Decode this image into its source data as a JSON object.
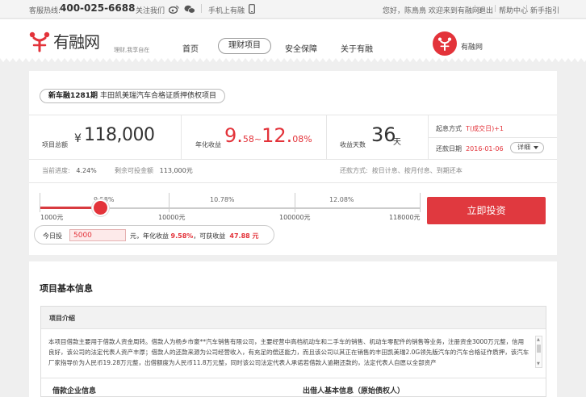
{
  "topbar": {
    "hotline_label": "客服热线:",
    "hotline_number": "400-025-6688",
    "follow_label": "关注我们",
    "mobile_label": "手机上有融",
    "greeting": "您好，陈鳥鳥 欢迎来到有融网!",
    "logout": "退出",
    "help": "帮助中心",
    "guide": "新手指引",
    "separator": "|"
  },
  "header": {
    "logo_text": "有融网",
    "slogan": "理财,我享自在",
    "nav": [
      {
        "label": "首页"
      },
      {
        "label": "理财项目",
        "active": true
      },
      {
        "label": "安全保障"
      },
      {
        "label": "关于有融"
      }
    ],
    "brand_name": "有融网",
    "accent_color": "#e3333a"
  },
  "project": {
    "code": "新车融1281期",
    "name": "丰田凯美瑞汽车合格证质押债权项目",
    "total_label": "项目总额",
    "currency": "¥",
    "total_amount": "118,000",
    "rate_label": "年化收益",
    "rate_min": "9.",
    "rate_min_dec": "58",
    "rate_sep": "~",
    "rate_max": "12.",
    "rate_max_dec": "08",
    "rate_pct": "%",
    "days_label": "收益天数",
    "days": "36",
    "days_unit": "天",
    "start_label": "起息方式",
    "start_value": "T(成交日)+1",
    "end_label": "还款日期",
    "end_value": "2016-01-06",
    "detail_label": "详细",
    "progress_label": "当前进度:",
    "progress_value": "4.24%",
    "remaining_label": "剩余可投金额",
    "remaining_value": "113,000元",
    "repay_label": "还款方式:",
    "repay_value": "按日计息、按月付息、到期还本"
  },
  "slider": {
    "segment_rates": [
      "9.58%",
      "10.78%",
      "12.08%"
    ],
    "axis_labels": [
      "1000元",
      "10000元",
      "100000元",
      "118000元"
    ],
    "current_fraction": 0.16
  },
  "calculator": {
    "label": "今日投",
    "amount": "5000",
    "rate_prefix": "元，年化收益",
    "rate_value": "9.58%",
    "income_prefix": "，可获收益",
    "income_value": "47.88 元"
  },
  "invest_button": "立即投资",
  "info": {
    "title": "项目基本信息",
    "intro_heading": "项目介绍",
    "intro_text": "本项目借款主要用于借款人资金周转。借款人为杨乡市豪**汽车销售有限公司，主要经营中高档机动车和二手车的销售、机动车零配件的销售等业务，注册资金3000万元整，信用良好，该公司的法定代表人资产丰厚；借款人的还款来源为公司经营收入，有充足的偿还能力，而且该公司以其正在销售的丰田凯美瑞2.0G领先版汽车的汽车合格证作质押，该汽车厂家指导价为人民币19.28万元整，出借额度为人民币11.8万元整，同时该公司法定代表人承诺若借款人逾期还款的，法定代表人自愿以全部资产",
    "left_subheading": "借款企业信息",
    "right_subheading": "出借人基本信息（原始债权人）"
  }
}
